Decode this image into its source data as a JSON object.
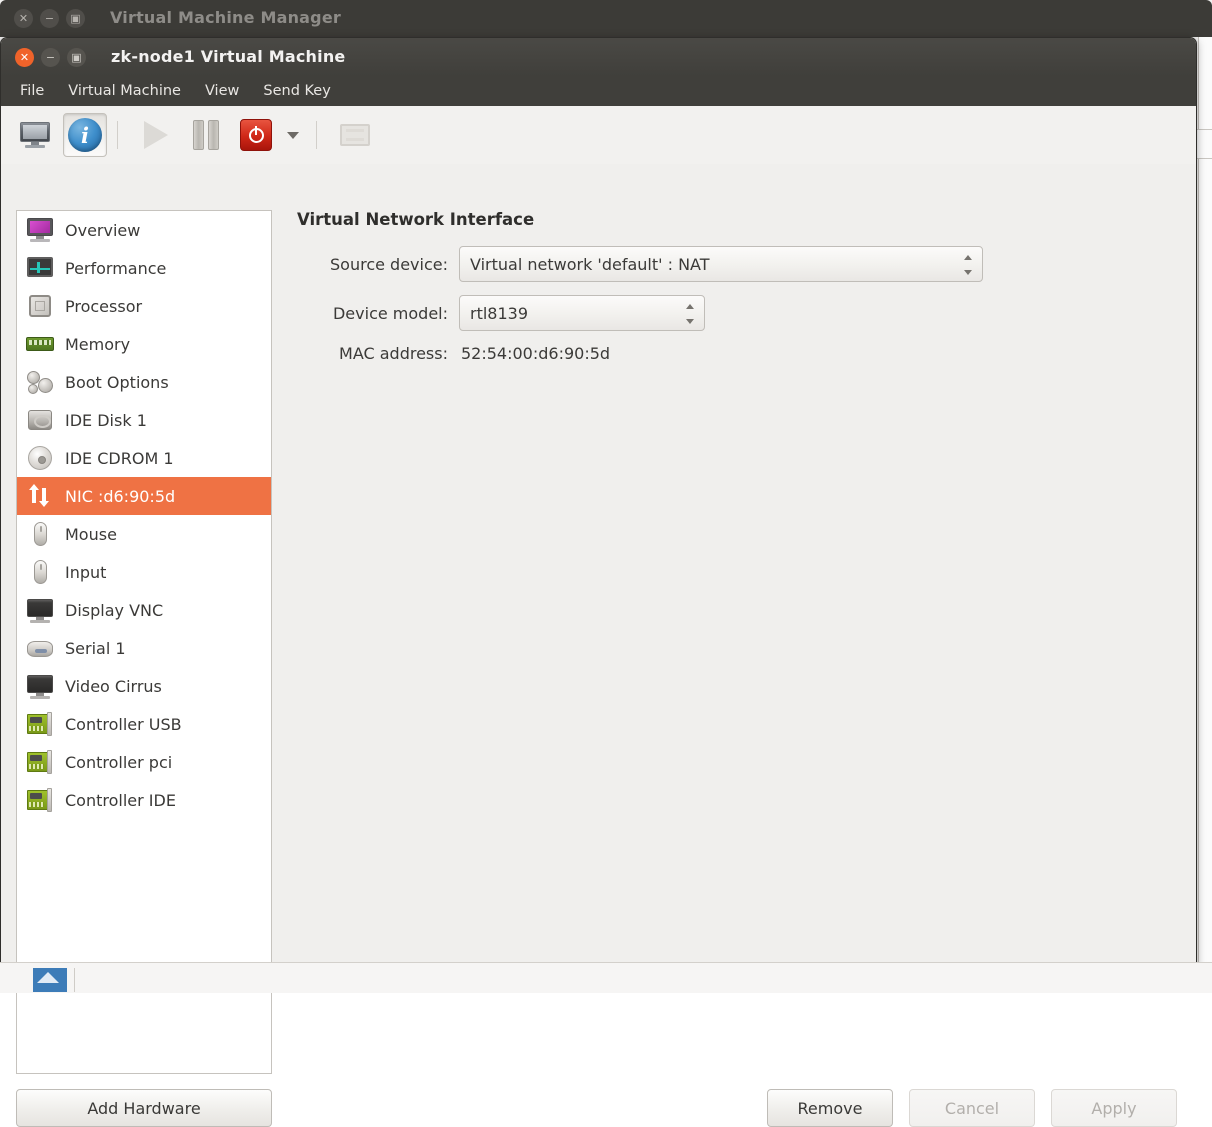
{
  "background_window": {
    "title": "Virtual Machine Manager",
    "close_icon": "close-icon",
    "minimize_icon": "minimize-icon",
    "maximize_icon": "maximize-icon",
    "status_text": ""
  },
  "vm_window": {
    "title": "zk-node1 Virtual Machine",
    "close_icon": "close-icon",
    "minimize_icon": "minimize-icon",
    "maximize_icon": "maximize-icon",
    "accent_color": "#f0632a"
  },
  "menubar": {
    "items": [
      {
        "label": "File"
      },
      {
        "label": "Virtual Machine"
      },
      {
        "label": "View"
      },
      {
        "label": "Send Key"
      }
    ]
  },
  "toolbar": {
    "buttons": [
      {
        "name": "console-view-button",
        "icon": "monitor-icon",
        "enabled": true,
        "pressed": false
      },
      {
        "name": "details-view-button",
        "icon": "info-icon",
        "enabled": true,
        "pressed": true
      },
      {
        "name": "run-button",
        "icon": "play-icon",
        "enabled": false,
        "pressed": false
      },
      {
        "name": "pause-button",
        "icon": "pause-icon",
        "enabled": true,
        "pressed": false
      },
      {
        "name": "shutdown-button",
        "icon": "power-icon",
        "enabled": true,
        "pressed": false
      },
      {
        "name": "shutdown-menu-button",
        "icon": "chevron-down-icon",
        "enabled": true,
        "pressed": false
      },
      {
        "name": "fullscreen-button",
        "icon": "fullscreen-icon",
        "enabled": false,
        "pressed": false
      }
    ]
  },
  "sidebar": {
    "selected_index": 8,
    "selected_color": "#ef7244",
    "items": [
      {
        "label": "Overview",
        "icon": "monitor-icon"
      },
      {
        "label": "Performance",
        "icon": "performance-graph-icon"
      },
      {
        "label": "Processor",
        "icon": "cpu-chip-icon"
      },
      {
        "label": "Memory",
        "icon": "memory-stick-icon"
      },
      {
        "label": "Boot Options",
        "icon": "gears-icon"
      },
      {
        "label": "IDE Disk 1",
        "icon": "hard-disk-icon"
      },
      {
        "label": "IDE CDROM 1",
        "icon": "cdrom-disc-icon"
      },
      {
        "label": "NIC :d6:90:5d",
        "icon": "network-arrows-icon"
      },
      {
        "label": "Mouse",
        "icon": "mouse-icon"
      },
      {
        "label": "Input",
        "icon": "mouse-icon"
      },
      {
        "label": "Display VNC",
        "icon": "display-icon"
      },
      {
        "label": "Serial 1",
        "icon": "serial-port-icon"
      },
      {
        "label": "Video Cirrus",
        "icon": "display-icon"
      },
      {
        "label": "Controller USB",
        "icon": "controller-card-icon"
      },
      {
        "label": "Controller pci",
        "icon": "controller-card-icon"
      },
      {
        "label": "Controller IDE",
        "icon": "controller-card-icon"
      }
    ],
    "add_hardware_label": "Add Hardware"
  },
  "panel": {
    "title": "Virtual Network Interface",
    "source_device": {
      "label": "Source device:",
      "value": "Virtual network 'default' : NAT"
    },
    "device_model": {
      "label": "Device model:",
      "value": "rtl8139"
    },
    "mac_address": {
      "label": "MAC address:",
      "value": "52:54:00:d6:90:5d"
    }
  },
  "actions": {
    "remove_label": "Remove",
    "cancel_label": "Cancel",
    "apply_label": "Apply"
  }
}
